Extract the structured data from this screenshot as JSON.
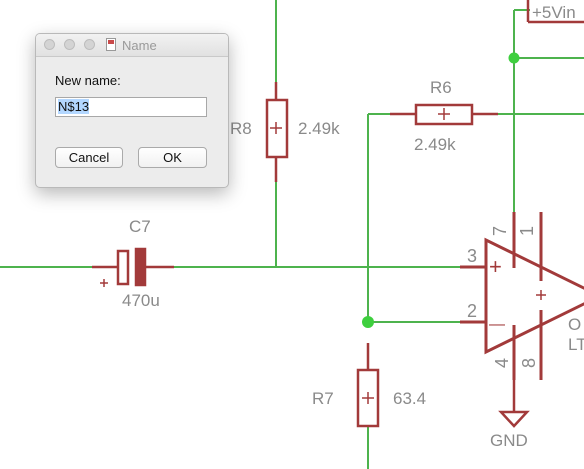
{
  "dialog": {
    "title": "Name",
    "field_label": "New name:",
    "value": "N$13",
    "cancel_label": "Cancel",
    "ok_label": "OK"
  },
  "schematic": {
    "power_label": "+5Vin",
    "r8": {
      "name": "R8",
      "value": "2.49k"
    },
    "r6": {
      "name": "R6",
      "value": "2.49k"
    },
    "c7": {
      "name": "C7",
      "value": "470u"
    },
    "r7": {
      "name": "R7",
      "value": "63.4"
    },
    "gnd_label": "GND",
    "opamp_pins": {
      "p3": "3",
      "p2": "2",
      "p7": "7",
      "p1": "1",
      "p4": "4",
      "p8": "8"
    },
    "opamp_plus": "+",
    "opamp_minus": "—",
    "opamp_label_o": "O",
    "opamp_label_lt": "LT",
    "colors": {
      "wire": "#4db34d",
      "part": "#a23a3a",
      "junction": "#3ecf3e",
      "label": "#8a8a8a"
    }
  }
}
